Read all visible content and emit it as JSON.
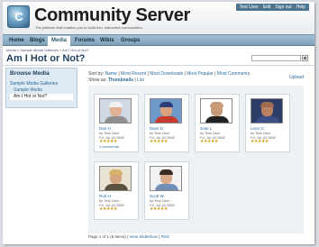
{
  "header": {
    "logo_glyph": "C",
    "site_title": "Community Server",
    "tagline": "The platform that enables you to build rich, interactive communities.",
    "user_links": [
      "Test User",
      "Edit",
      "Sign out",
      "Help"
    ]
  },
  "nav": {
    "items": [
      {
        "label": "Home",
        "active": false
      },
      {
        "label": "Blogs",
        "active": false
      },
      {
        "label": "Media",
        "active": true
      },
      {
        "label": "Forums",
        "active": false
      },
      {
        "label": "Wikis",
        "active": false
      },
      {
        "label": "Groups",
        "active": false
      }
    ]
  },
  "breadcrumb": "Media » Sample Media Galleries » Am I Hot or Not?",
  "page_title": "Am I Hot or Not?",
  "search": {
    "placeholder": ""
  },
  "sidebar": {
    "title": "Browse Media",
    "gallery_link": "Sample Media Galleries",
    "media_link": "Sample Media",
    "current_link": "Am I Hot or Not?"
  },
  "toolbar": {
    "sort_label": "Sort by:",
    "sort_options": [
      "Name",
      "Most Recent",
      "Most Downloads",
      "Most Popular",
      "Most Comments"
    ],
    "show_label": "Show as:",
    "show_options": [
      "Thumbnails",
      "List"
    ],
    "upload_label": "Upload"
  },
  "items": [
    {
      "name": "Dan H",
      "by": "by Test User",
      "date": "Fri, Jul 18 2008",
      "stars": "★★★★★",
      "rating": 5,
      "comments": "1 comments",
      "colors": {
        "bg": "#cfd8e3",
        "hat": "#f1f1f1",
        "body": "#8f8f8f",
        "skin": "#e0b194"
      }
    },
    {
      "name": "Dave D",
      "by": "by Test User",
      "date": "Fri, Jul 18 2008",
      "stars": "★★★★★",
      "rating": 5,
      "comments": "",
      "colors": {
        "bg": "#6e98c8",
        "hat": "#2b3f7a",
        "body": "#c53c2f",
        "skin": "#d8a27e"
      }
    },
    {
      "name": "Jose L",
      "by": "by Test User",
      "date": "Fri, Jul 18 2008",
      "stars": "★★★★★",
      "rating": 5,
      "comments": "",
      "colors": {
        "bg": "#ffffff",
        "hat": "#c79a78",
        "body": "#222222",
        "skin": "#c79a78"
      }
    },
    {
      "name": "Leon G",
      "by": "by Test User",
      "date": "Fri, Jul 18 2008",
      "stars": "★★★★★",
      "rating": 5,
      "comments": "",
      "colors": {
        "bg": "#2d3d66",
        "hat": "#9e6b4c",
        "body": "#3a4f86",
        "skin": "#b98161"
      }
    },
    {
      "name": "Rob H",
      "by": "by Test User",
      "date": "Fri, Jul 18 2008",
      "stars": "★★★★★",
      "rating": 5,
      "comments": "",
      "colors": {
        "bg": "#e9e3d4",
        "hat": "#d6b36d",
        "body": "#5a5040",
        "skin": "#d5a67f"
      }
    },
    {
      "name": "Scott W",
      "by": "by Test User",
      "date": "Fri, Jul 18 2008",
      "stars": "★★★★★",
      "rating": 5,
      "comments": "",
      "colors": {
        "bg": "#f2f2f2",
        "hat": "#3b2a20",
        "body": "#6f8fb4",
        "skin": "#d9ab8b"
      }
    }
  ],
  "pager": {
    "text": "Page 1 of 1 (6 items)",
    "slideshow": "View Slideshow",
    "rss": "RSS"
  },
  "colors": {
    "nav_bg": "#8fb0c5",
    "sidebar_bg": "#dfeaf3",
    "link": "#2d6a9a",
    "title": "#1c3f5c",
    "star": "#d39b13"
  }
}
